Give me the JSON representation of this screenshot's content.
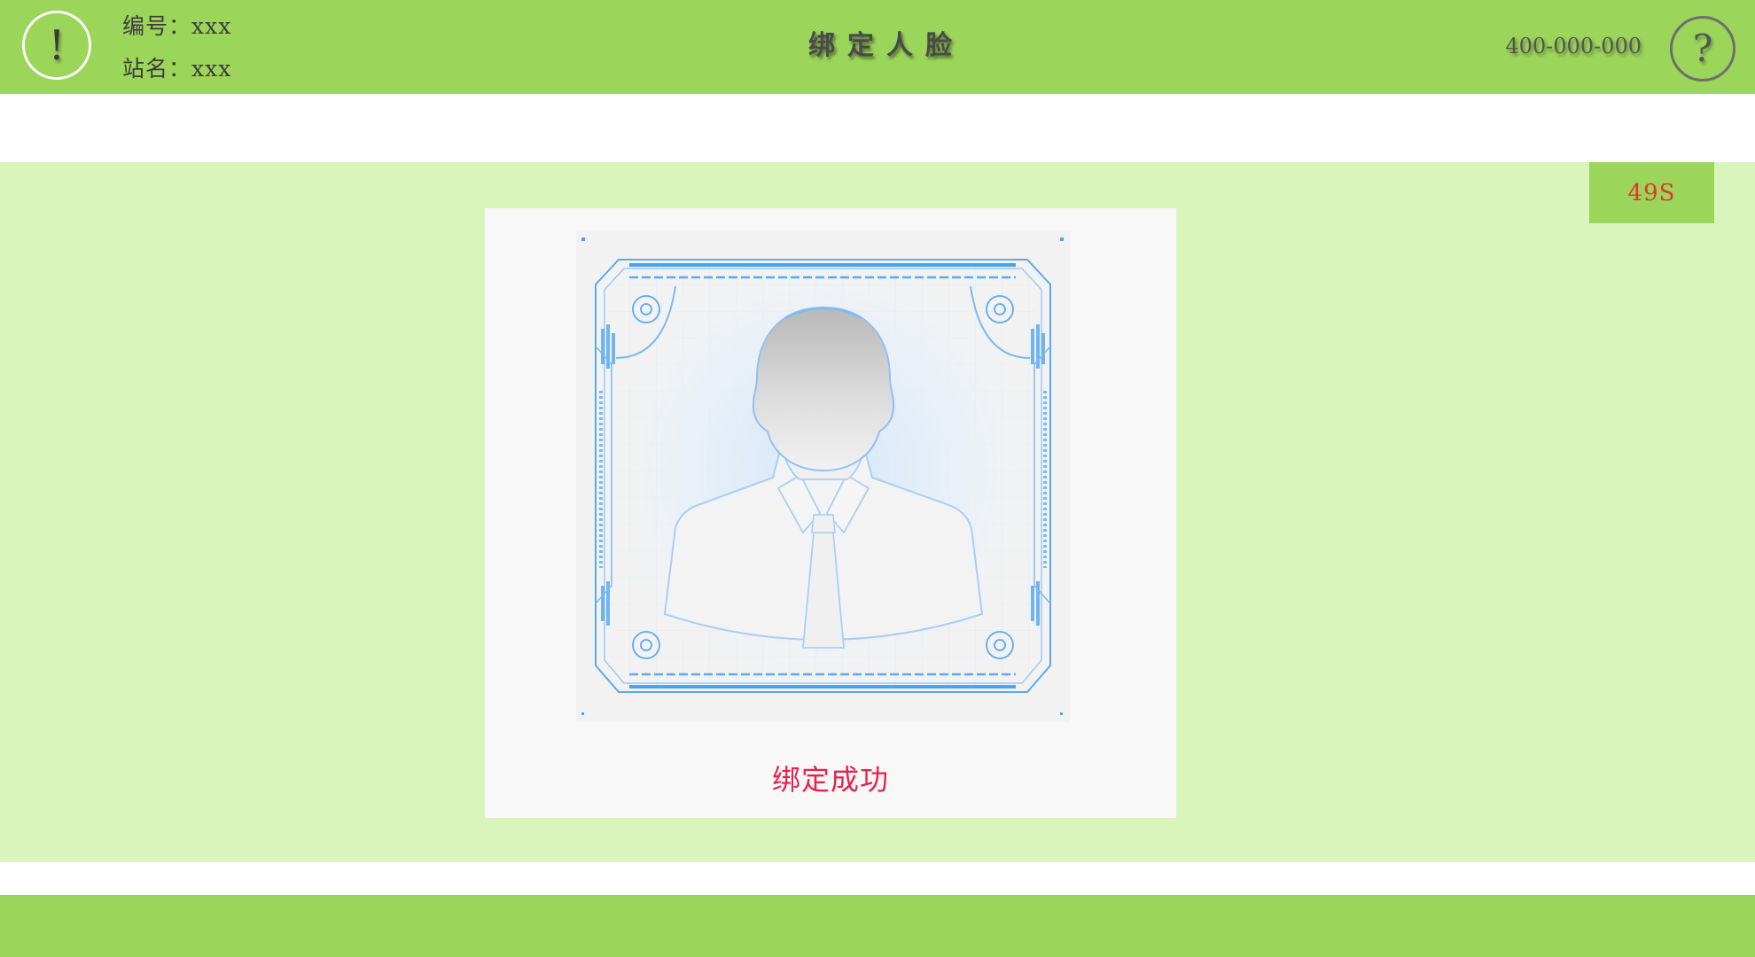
{
  "header": {
    "alert_icon": "exclamation-icon",
    "alert_glyph": "!",
    "station_id_label": "编号：xxx",
    "station_name_label": "站名：xxx",
    "title": "绑定人脸",
    "hotline": "400-000-000",
    "help_icon": "question-mark-icon",
    "help_glyph": "?"
  },
  "countdown": {
    "text": "49S"
  },
  "face_card": {
    "placeholder_icon": "person-silhouette-icon",
    "status_text": "绑定成功"
  },
  "colors": {
    "header_bg": "#9bd55a",
    "main_bg": "#daf5bb",
    "card_bg": "#f8f8f8",
    "frame_blue": "#4aa3f0",
    "status_red": "#e5234e",
    "countdown_red": "#e2352e"
  }
}
